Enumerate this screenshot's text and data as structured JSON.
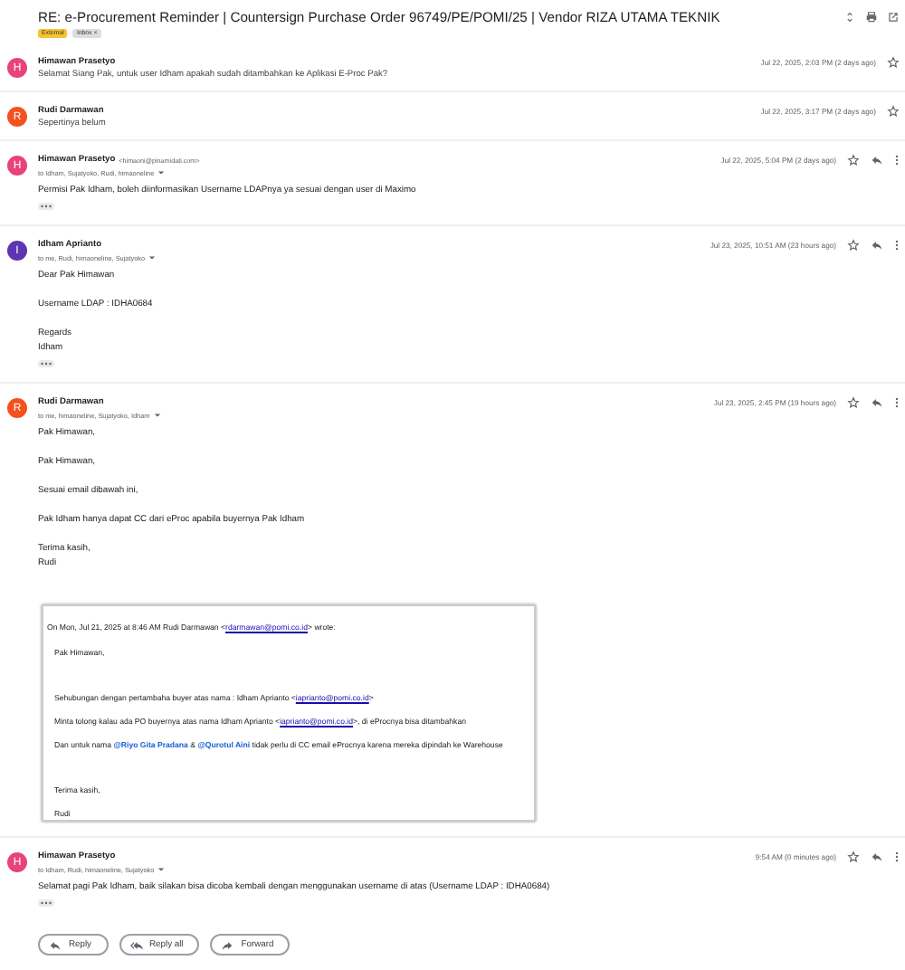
{
  "subject": "RE: e-Procurement Reminder | Countersign Purchase Order 96749/PE/POMI/25 | Vendor RIZA UTAMA TEKNIK",
  "labels": [
    {
      "text": "External",
      "color": "#f7c531"
    },
    {
      "text": "Inbox",
      "color": "#dddddd",
      "remove": "×"
    }
  ],
  "messages": [
    {
      "kind": "collapsed",
      "initial": "H",
      "color": "#e8437b",
      "sender": "Himawan Prasetyo",
      "snippet": "Selamat Siang Pak, untuk user Idham apakah sudah ditambahkan ke Aplikasi E-Proc Pak?",
      "date": "Jul 22, 2025, 2:03 PM (2 days ago)"
    },
    {
      "kind": "collapsed",
      "initial": "R",
      "color": "#f4511e",
      "sender": "Rudi Darmawan",
      "snippet": "Sepertinya belum",
      "date": "Jul 22, 2025, 3:17 PM (2 days ago)"
    },
    {
      "kind": "expanded",
      "initial": "H",
      "color": "#e8437b",
      "sender": "Himawan Prasetyo",
      "email": "<himaoni@pinamidati.com>",
      "recipients": "to Idham, Sujatyoko, Rudi, himaoneline",
      "date": "Jul 22, 2025, 5:04 PM (2 days ago)",
      "body": [
        [
          "Permisi Pak Idham, boleh diinformasikan Username LDAPnya ya sesuai dengan user di Maximo"
        ]
      ],
      "trimmed": true
    },
    {
      "kind": "expanded",
      "initial": "I",
      "color": "#5e35b1",
      "sender": "Idham Aprianto",
      "recipients": "to me, Rudi, himaoneline, Sujatyoko",
      "date": "Jul 23, 2025, 10:51 AM (23 hours ago)",
      "body": [
        [
          "Dear Pak Himawan"
        ],
        [
          "Username LDAP : IDHA0684"
        ],
        [
          "Regards",
          "Idham"
        ]
      ],
      "trimmed": true
    },
    {
      "kind": "expanded",
      "initial": "R",
      "color": "#f4511e",
      "sender": "Rudi Darmawan",
      "recipients": "to me, himaoneline, Sujatyoko, Idham",
      "date": "Jul 23, 2025, 2:45 PM (19 hours ago)",
      "body": [
        [
          "Pak Himawan,"
        ],
        [
          "Pak Himawan,"
        ],
        [
          "Sesuai email dibawah ini,"
        ],
        [
          "Pak Idham hanya dapat CC dari eProc apabila buyernya Pak Idham"
        ],
        [
          "Terima kasih,",
          "Rudi"
        ]
      ],
      "quote": {
        "header": [
          {
            "kind": "text",
            "text": "On Mon, Jul 21, 2025 at 8:46 AM Rudi Darmawan <"
          },
          {
            "kind": "link",
            "text": "rdarmawan@pomi.co.id"
          },
          {
            "kind": "text",
            "text": "> wrote:"
          }
        ],
        "groups": [
          [
            [
              {
                "kind": "text",
                "text": "Pak Himawan,"
              }
            ]
          ],
          [
            [
              {
                "kind": "text",
                "text": "Sehubungan dengan pertambaha buyer atas  nama : Idham Aprianto <"
              },
              {
                "kind": "link",
                "text": "iaprianto@pomi.co.id"
              },
              {
                "kind": "text",
                "text": ">"
              }
            ],
            [
              {
                "kind": "text",
                "text": "Minta tolong kalau ada PO buyernya atas nama Idham Aprianto <"
              },
              {
                "kind": "link",
                "text": "iaprianto@pomi.co.id"
              },
              {
                "kind": "text",
                "text": ">, di eProcnya bisa ditambahkan"
              }
            ],
            [
              {
                "kind": "text",
                "text": "Dan untuk nama "
              },
              {
                "kind": "mention",
                "text": "@Riyo Gita Pradana"
              },
              {
                "kind": "text",
                "text": " & "
              },
              {
                "kind": "mention",
                "text": "@Qurotul Aini"
              },
              {
                "kind": "text",
                "text": " tidak perlu di CC email eProcnya  karena mereka dipindah ke Warehouse"
              }
            ]
          ],
          [
            [
              {
                "kind": "text",
                "text": "Terima kasih,"
              }
            ],
            [
              {
                "kind": "text",
                "text": "Rudi"
              }
            ]
          ]
        ]
      }
    },
    {
      "kind": "expanded",
      "initial": "H",
      "color": "#e8437b",
      "sender": "Himawan Prasetyo",
      "recipients": "to Idham, Rudi, himaoneline, Sujatyoko",
      "date": "9:54 AM (0 minutes ago)",
      "body": [
        [
          "Selamat pagi Pak Idham, baik silakan bisa dicoba kembali dengan menggunakan username di atas (Username LDAP : IDHA0684)"
        ]
      ],
      "trimmed": true
    }
  ],
  "actions": [
    {
      "kind": "reply",
      "label": "Reply"
    },
    {
      "kind": "reply_all",
      "label": "Reply all"
    },
    {
      "kind": "forward",
      "label": "Forward"
    }
  ]
}
